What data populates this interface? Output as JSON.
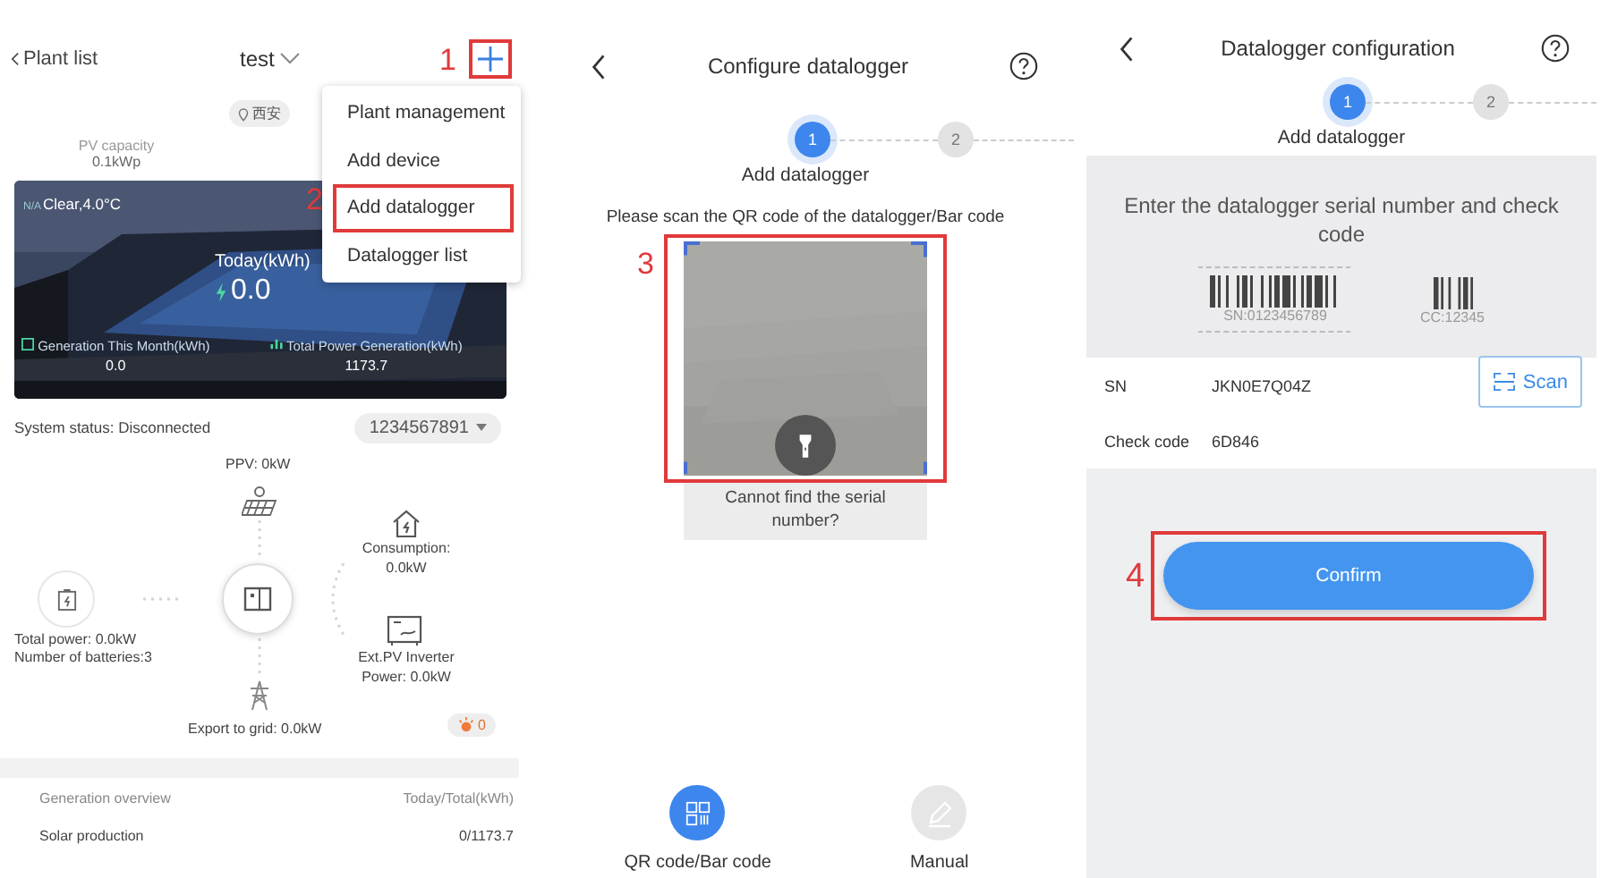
{
  "plant_screen": {
    "back_link": "Plant list",
    "plant_name": "test",
    "add_step_label": "1",
    "add_highlighted": true,
    "location": "西安",
    "pv_capacity": {
      "label": "PV capacity",
      "value": "0.1kWp"
    },
    "weather": {
      "prefix": "N/A",
      "text": "Clear,4.0°C"
    },
    "today": {
      "label": "Today(kWh)",
      "value": "0.0"
    },
    "month": {
      "label": "Generation This Month(kWh)",
      "value": "0.0"
    },
    "total": {
      "label": "Total Power Generation(kWh)",
      "value": "1173.7"
    },
    "menu": {
      "step_label": "2",
      "items": [
        {
          "label": "Plant management",
          "highlighted": false
        },
        {
          "label": "Add device",
          "highlighted": false
        },
        {
          "label": "Add datalogger",
          "highlighted": true
        },
        {
          "label": "Datalogger list",
          "highlighted": false
        }
      ]
    },
    "status": {
      "label": "System status:",
      "value": "Disconnected"
    },
    "device_sn": "1234567891",
    "flow": {
      "ppv": "PPV: 0kW",
      "consumption": [
        "Consumption:",
        "0.0kW"
      ],
      "battery": [
        "Total power: 0.0kW",
        "Number of batteries:3"
      ],
      "ext_inverter": [
        "Ext.PV Inverter",
        "Power: 0.0kW"
      ],
      "grid": "Export to grid: 0.0kW",
      "alarm_count": "0"
    },
    "overview": {
      "title": "Generation overview",
      "unit": "Today/Total(kWh)",
      "rows": [
        {
          "label": "Solar production",
          "value": "0/1173.7"
        }
      ]
    }
  },
  "scan_screen": {
    "title": "Configure datalogger",
    "steps": [
      {
        "label": "1",
        "selected": true
      },
      {
        "label": "2",
        "selected": false
      }
    ],
    "step_title": "Add datalogger",
    "instruction": "Please scan the QR code of the datalogger/Bar code",
    "step_label": "3",
    "scanner_highlighted": true,
    "help_text": "Cannot find the serial number?",
    "modes": [
      {
        "kind": "qr",
        "label": "QR code/Bar code",
        "selected": true
      },
      {
        "kind": "manual",
        "label": "Manual",
        "selected": false
      }
    ]
  },
  "manual_screen": {
    "title": "Datalogger configuration",
    "steps": [
      {
        "label": "1",
        "selected": true
      },
      {
        "label": "2",
        "selected": false
      }
    ],
    "step_title": "Add datalogger",
    "hint": "Enter the datalogger serial number and check code",
    "sample_sn": "SN:0123456789",
    "sample_cc": "CC:12345",
    "fields": [
      {
        "label": "SN",
        "value": "JKN0E7Q04Z"
      },
      {
        "label": "Check code",
        "value": "6D846"
      }
    ],
    "scan_button": "Scan",
    "confirm": {
      "label": "Confirm",
      "highlighted": true,
      "step_label": "4"
    }
  }
}
